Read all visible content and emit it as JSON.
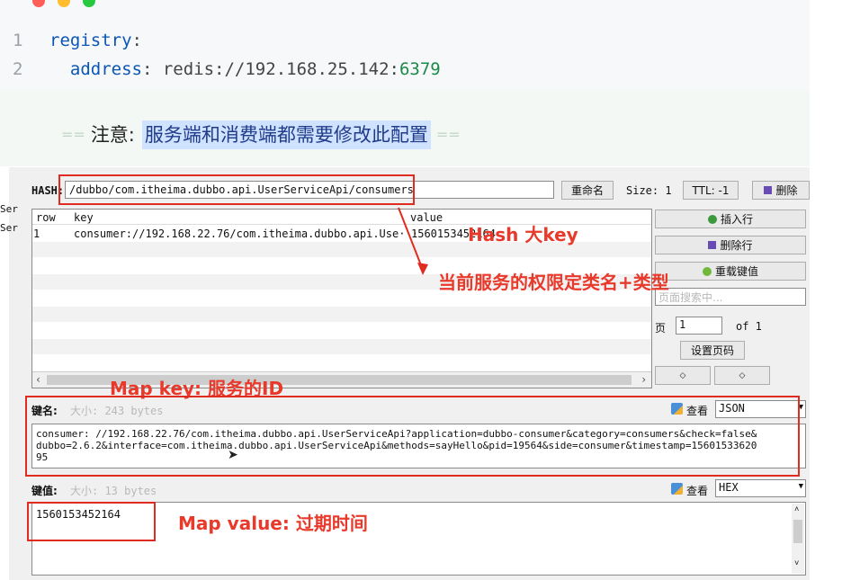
{
  "code": {
    "lines": [
      {
        "num": "1",
        "key": "registry",
        "colon": ":"
      },
      {
        "num": "2",
        "key": "address",
        "colon": ":",
        "value_prefix": " redis://192.168.25.142:",
        "port": "6379"
      }
    ]
  },
  "note": {
    "eq_left": "==",
    "label": "注意:",
    "highlight": "服务端和消费端都需要修改此配置",
    "eq_right": "=="
  },
  "redis": {
    "hash_label": "HASH:",
    "hash_key": "/dubbo/com.itheima.dubbo.api.UserServiceApi/consumers",
    "rename_label": "重命名",
    "size_text": "Size: 1",
    "ttl_text": "TTL: -1",
    "delete_label": "删除",
    "side_labels": [
      "Ser",
      "Ser"
    ],
    "columns": [
      "row",
      "key",
      "value"
    ],
    "rows": [
      {
        "row": "1",
        "key": "consumer://192.168.22.76/com.itheima.dubbo.api.Use···",
        "value": "1560153452164"
      }
    ],
    "insert_row_label": "插入行",
    "delete_row_label": "删除行",
    "reload_label": "重载键值",
    "page_search_placeholder": "页面搜索中...",
    "page_label": "页",
    "page_value": "1",
    "page_of": "of 1",
    "set_page_label": "设置页码",
    "key_name_label": "键名:",
    "key_size_hint": "大小: 243 bytes",
    "view_label": "查看",
    "key_format": "JSON",
    "key_text_line1": "consumer: //192.168.22.76/com.itheima.dubbo.api.UserServiceApi?application=dubbo-consumer&category=consumers&check=false&",
    "key_text_line2": "dubbo=2.6.2&interface=com.itheima.dubbo.api.UserServiceApi&methods=sayHello&pid=19564&side=consumer&timestamp=15601533620",
    "key_text_line3": "95",
    "value_label": "键值:",
    "value_size_hint": "大小: 13 bytes",
    "value_format": "HEX",
    "value_text": "1560153452164"
  },
  "annotations": {
    "hash_big_key": "Hash 大key",
    "qualified_name": "当前服务的权限定类名+类型",
    "map_key": "Map key:  服务的ID",
    "map_value": "Map value:  过期时间"
  },
  "colors": {
    "annotation_red": "#e8392b",
    "highlight_bg": "#cfe2ff",
    "code_key_blue": "#0b55b5",
    "code_port_green": "#1d8a4a"
  }
}
